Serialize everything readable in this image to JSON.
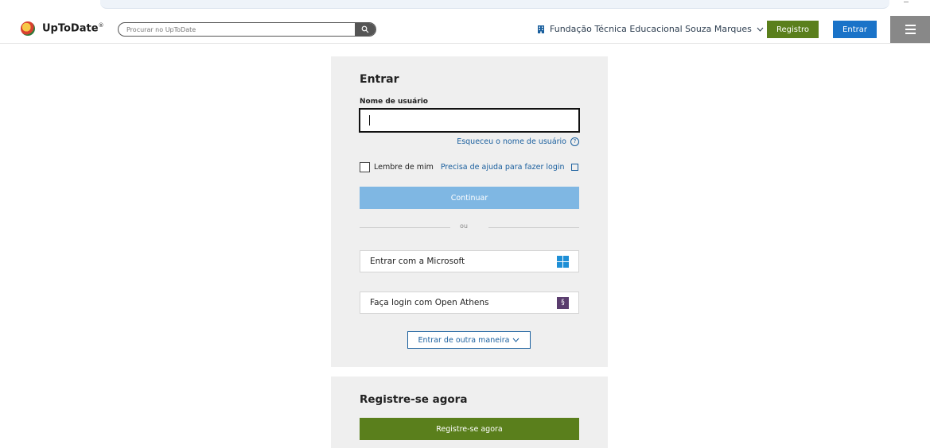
{
  "header": {
    "logo_text": "UpToDate",
    "logo_mark": "®",
    "search_placeholder": "Procurar no UpToDate",
    "institution": "Fundação Técnica Educacional Souza Marques",
    "register_label": "Registro",
    "login_label": "Entrar"
  },
  "login": {
    "title": "Entrar",
    "username_label": "Nome de usuário",
    "username_value": "",
    "forgot_username": "Esqueceu o nome de usuário",
    "remember_me": "Lembre de mim",
    "help_login": "Precisa de ajuda para fazer login",
    "continue_label": "Continuar",
    "divider_text": "ou",
    "microsoft_label": "Entrar com a Microsoft",
    "openathens_label": "Faça login com Open Athens",
    "other_way_label": "Entrar de outra maneira"
  },
  "register": {
    "title": "Registre-se agora",
    "button_label": "Registre-se agora"
  },
  "colors": {
    "brand_green": "#5a7f1c",
    "brand_blue": "#1a73c8",
    "link_blue": "#1a5f9e",
    "continue_disabled": "#7fb7e3"
  },
  "icons": {
    "search": "search-icon",
    "institution": "building-icon",
    "chevron": "chevron-down-icon",
    "menu": "hamburger-menu-icon",
    "help": "help-circle-icon",
    "external": "external-link-icon",
    "microsoft": "microsoft-logo-icon",
    "openathens": "openathens-logo-icon"
  }
}
